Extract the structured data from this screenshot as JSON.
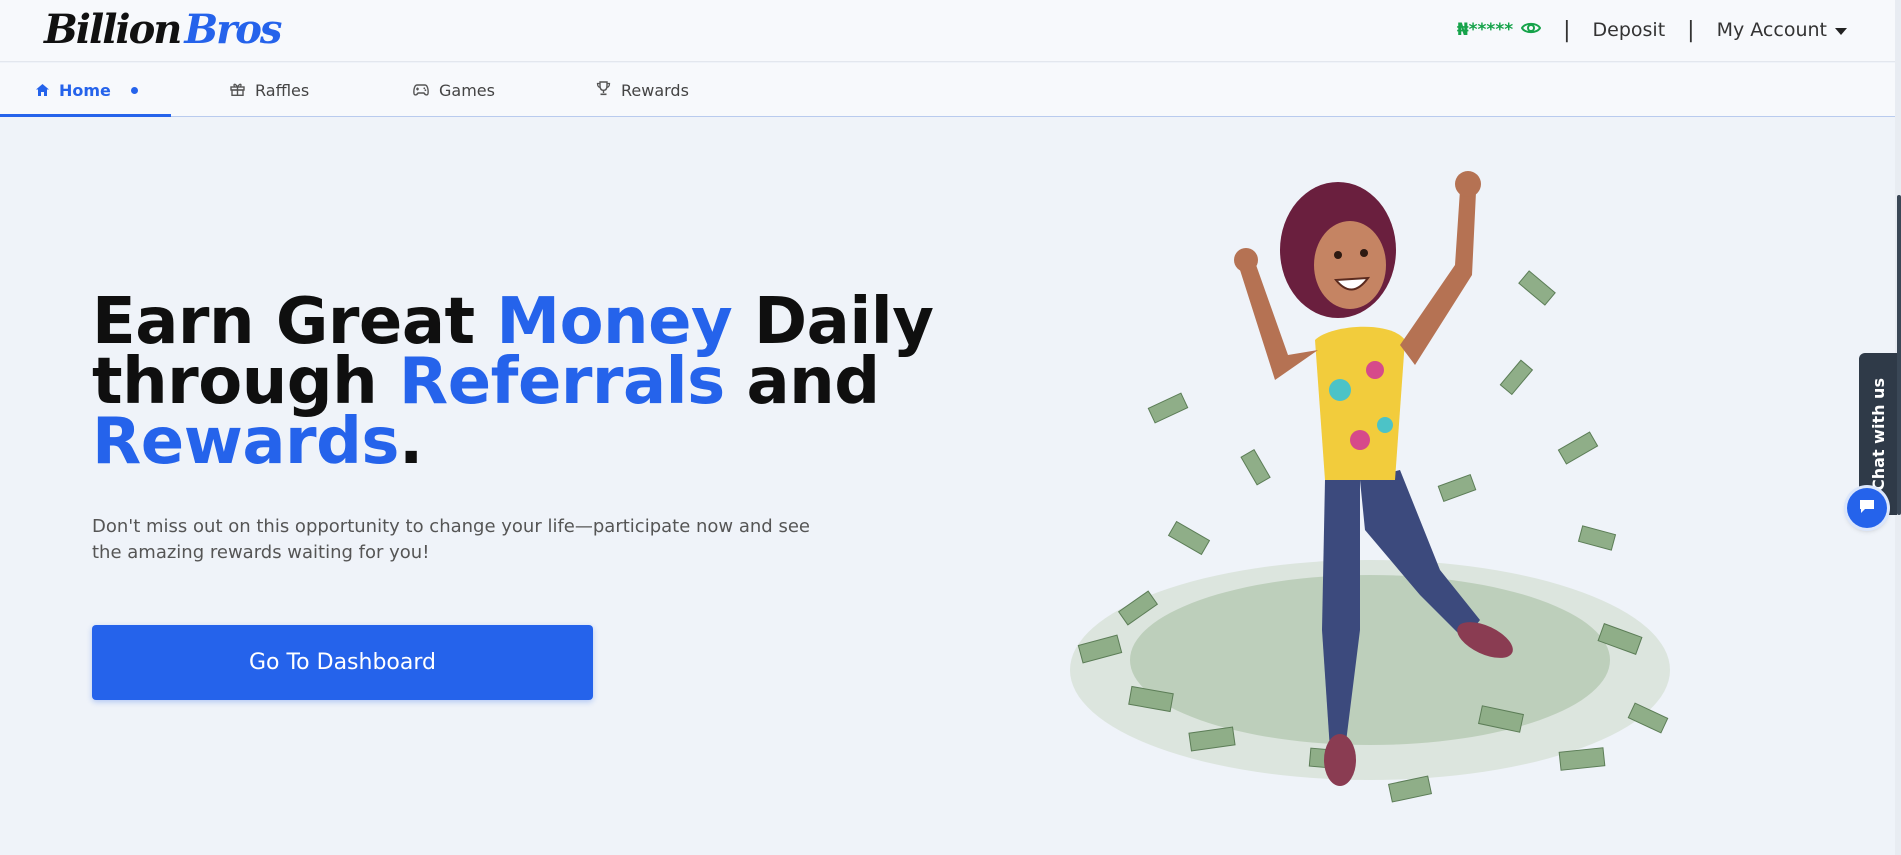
{
  "header": {
    "logo_part1": "Billion",
    "logo_part2": "Bros",
    "balance": "₦*****",
    "separator": "|",
    "deposit_label": "Deposit",
    "account_label": "My Account"
  },
  "tabs": [
    {
      "label": "Home",
      "icon": "home-icon",
      "active": true
    },
    {
      "label": "Raffles",
      "icon": "gift-icon",
      "active": false
    },
    {
      "label": "Games",
      "icon": "gamepad-icon",
      "active": false
    },
    {
      "label": "Rewards",
      "icon": "trophy-icon",
      "active": false
    }
  ],
  "hero": {
    "headline": {
      "l1a": "Earn Great ",
      "l1b": "Money",
      "l1c": " Daily",
      "l2a": "through ",
      "l2b": "Referrals",
      "l2c": " and",
      "l3a": "Rewards",
      "l3b": "."
    },
    "subtext": "Don't miss out on this opportunity to change your life—participate now and see the amazing rewards waiting for you!",
    "cta_label": "Go To Dashboard"
  },
  "chat": {
    "tab_label": "Chat with us",
    "bubble_icon": "chat-icon"
  },
  "colors": {
    "accent": "#2563eb",
    "balance": "#16a34a",
    "background": "#eff3f9"
  }
}
